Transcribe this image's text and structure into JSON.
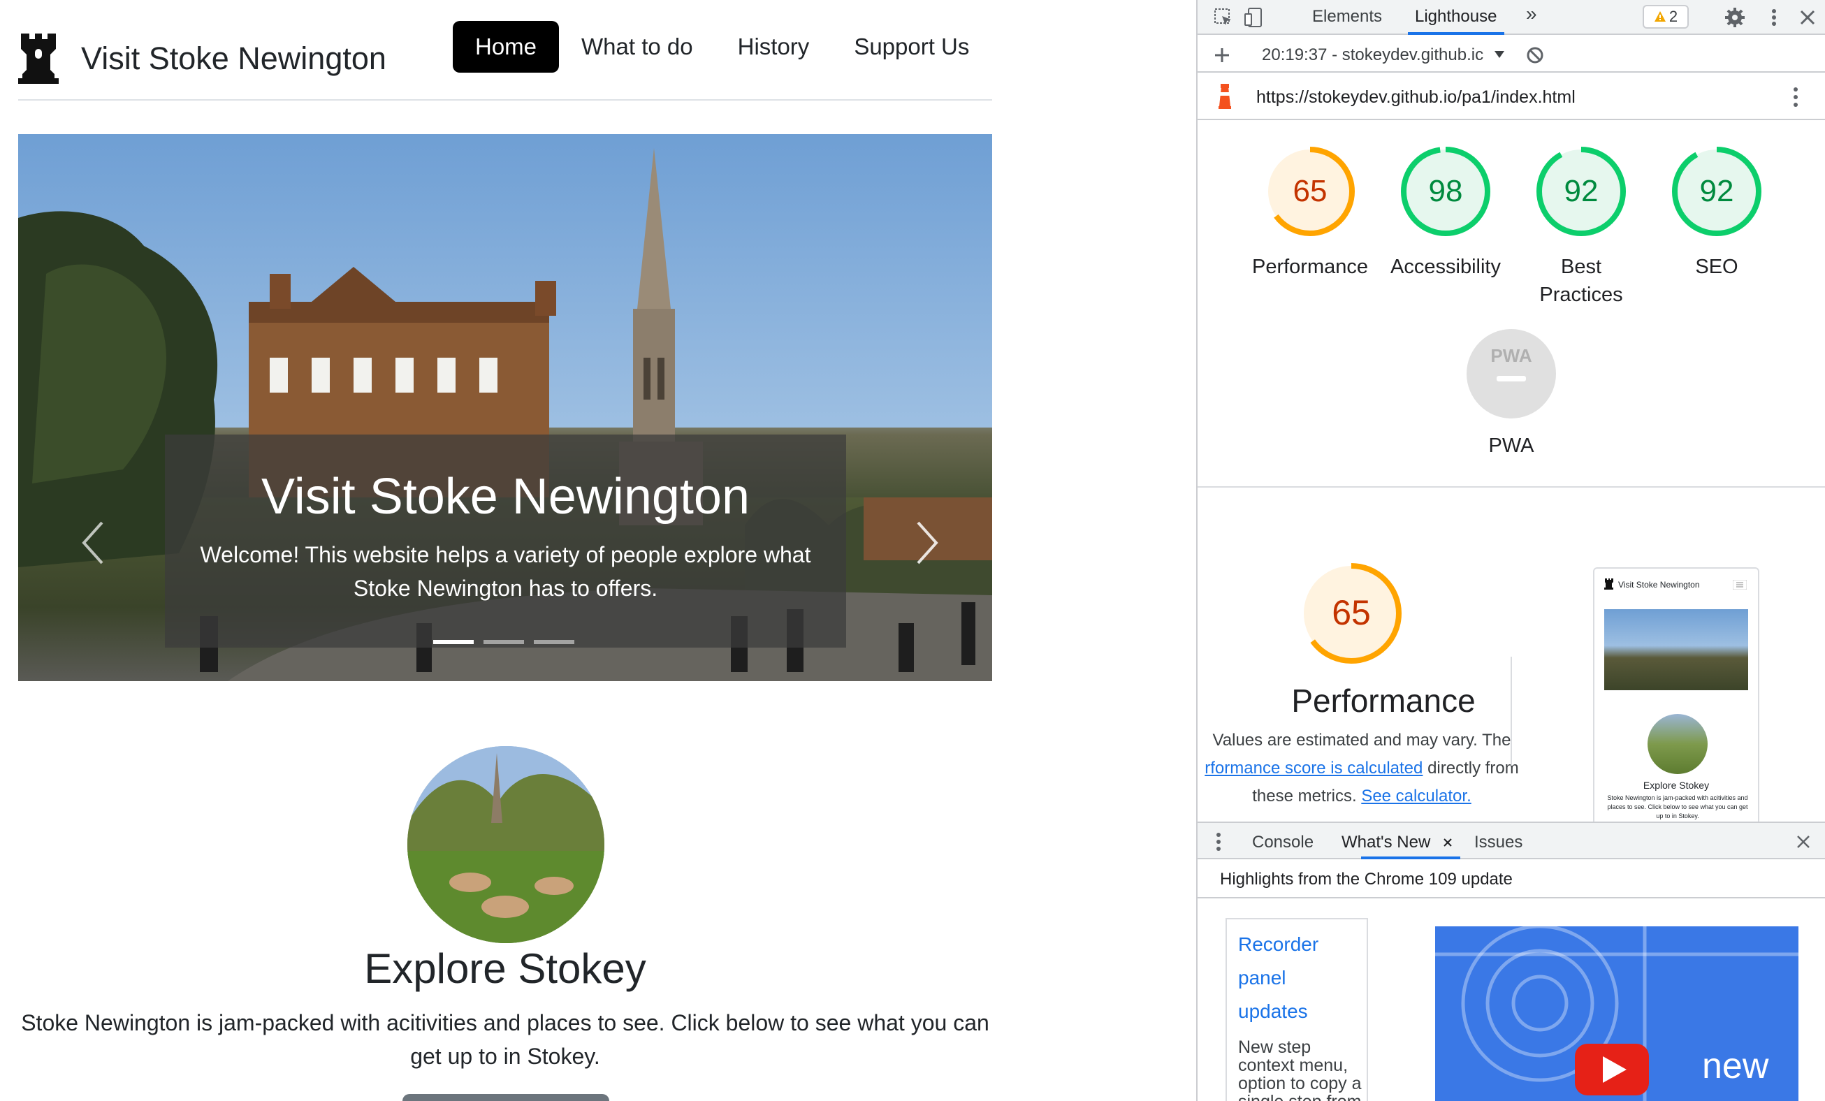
{
  "site": {
    "brand": "Visit Stoke Newington",
    "nav": [
      {
        "label": "Home",
        "active": true
      },
      {
        "label": "What to do",
        "active": false
      },
      {
        "label": "History",
        "active": false
      },
      {
        "label": "Support Us",
        "active": false
      }
    ],
    "carousel": {
      "title": "Visit Stoke Newington",
      "text": "Welcome! This website helps a variety of people explore what Stoke Newington has to offers.",
      "slide_count": 3,
      "active_slide": 1
    },
    "explore": {
      "title": "Explore Stokey",
      "text": "Stoke Newington is jam-packed with acitivities and places to see. Click below to see what you can get up to in Stokey."
    }
  },
  "devtools": {
    "tabs": {
      "elements": "Elements",
      "lighthouse": "Lighthouse",
      "more": "»"
    },
    "warnings": "2",
    "report_selector": "20:19:37 - stokeydev.github.ic",
    "url": "https://stokeydev.github.io/pa1/index.html",
    "scores": {
      "performance": {
        "value": "65",
        "label": "Performance",
        "color": "#fa3"
      },
      "accessibility": {
        "value": "98",
        "label": "Accessibility",
        "color": "#0c6"
      },
      "best_practices": {
        "value": "92",
        "label_line1": "Best",
        "label_line2": "Practices",
        "color": "#0c6"
      },
      "seo": {
        "value": "92",
        "label": "SEO",
        "color": "#0c6"
      },
      "pwa": {
        "label": "PWA",
        "badge": "PWA"
      }
    },
    "perf_detail": {
      "score": "65",
      "title": "Performance",
      "desc_1": "Values are estimated and may vary. The",
      "desc_link1": "rformance score is calculated",
      "desc_2": "directly from",
      "desc_3": "these metrics.",
      "desc_link2": "See calculator."
    },
    "thumbnail": {
      "brand": "Visit Stoke Newington",
      "heading": "Explore Stokey",
      "text": "Stoke Newington is jam-packed with acitivities and places to see. Click below to see what you can get up to in Stokey."
    },
    "drawer": {
      "tabs": {
        "console": "Console",
        "whats_new": "What's New",
        "issues": "Issues"
      },
      "highlights": "Highlights from the Chrome 109 update",
      "card_title_1": "Recorder",
      "card_title_2": "panel",
      "card_title_3": "updates",
      "card_desc": "New step context menu, option to copy a single step from a",
      "video_text": "new"
    },
    "colors": {
      "accent": "#1a73e8",
      "perf_orange": "#ffa400",
      "good_green": "#0cce6b"
    }
  }
}
